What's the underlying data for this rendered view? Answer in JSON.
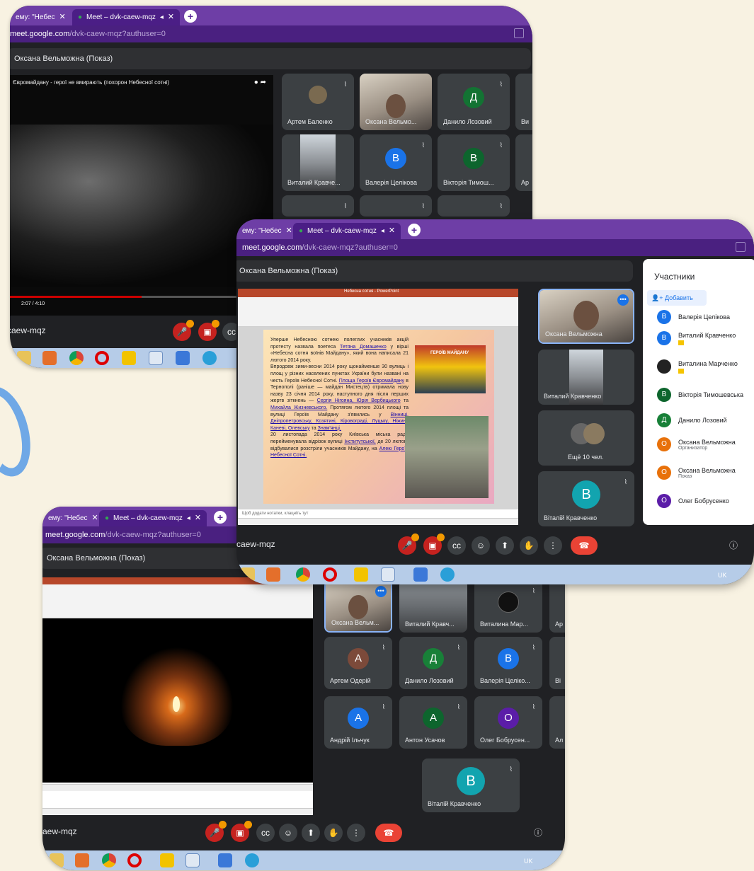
{
  "colors": {
    "bg": "#f8f2e2",
    "meet_bg": "#202124",
    "tab_bar": "#6e3ea6",
    "tile": "#3c4043",
    "end_call": "#ea4335",
    "blue": "#1a73e8",
    "green": "#137333",
    "orange": "#e8710a"
  },
  "windows": [
    {
      "tab1": "ему: \"Небес",
      "tab2": "Meet – dvk-caew-mqz",
      "url_main": "meet.google.com",
      "url_rest": "/dvk-caew-mqz?authuser=0",
      "presenting": "Оксана Вельможна (Показ)",
      "meeting": "caew-mqz",
      "video_title": "Євромайдану - герої не вмирають (похорон Небесної сотні)",
      "time": "2:07 / 4:10",
      "tiles": [
        {
          "name": "Артем Баленко"
        },
        {
          "name": "Оксана Вельмо..."
        },
        {
          "name": "Данило Лозовий",
          "letter": "Д"
        },
        {
          "name": "Ви"
        },
        {
          "name": "Виталий Кравче..."
        },
        {
          "name": "Валерія Целікова",
          "letter": "B"
        },
        {
          "name": "Вікторія Тимош...",
          "letter": "B"
        },
        {
          "name": "Ар"
        }
      ]
    },
    {
      "tab1": "ему: \"Небес",
      "tab2": "Meet – dvk-caew-mqz",
      "url_main": "meet.google.com",
      "url_rest": "/dvk-caew-mqz?authuser=0",
      "presenting": "Оксана Вельможна (Показ)",
      "meeting": "caew-mqz",
      "ppt_title": "Небесна сотня - PowerPoint",
      "tiles": [
        {
          "name": "Оксана Вельможна"
        },
        {
          "name": "Виталий Кравченко"
        },
        {
          "name": "Ещё 10 чел."
        },
        {
          "name": "Віталій Кравченко",
          "letter": "B"
        }
      ],
      "panel": {
        "title": "Участники",
        "add": "Добавить",
        "people": [
          {
            "name": "Валерія Целікова",
            "letter": "B"
          },
          {
            "name": "Виталий Кравченко",
            "letter": "B"
          },
          {
            "name": "Виталина Марченко",
            "letter": ""
          },
          {
            "name": "Вікторія Тимошевська",
            "letter": "B"
          },
          {
            "name": "Данило Лозовий",
            "letter": "Д"
          },
          {
            "name": "Оксана Вельможна",
            "letter": "O",
            "sub": "Организатор"
          },
          {
            "name": "Оксана Вельможна",
            "letter": "O",
            "sub": "Показ"
          },
          {
            "name": "Олег Бобрусенко",
            "letter": "O"
          }
        ]
      },
      "slide": {
        "p1": "Уперше Небесною сотнею полеглих учасників акцій протесту назвала поетеса",
        "l1": "Тетяна Домашенко",
        "p2": "у вірші «Небесна сотня воїнів Майдану», який вона написала 21 лютого 2014 року.",
        "p3": "Впродовж зими-весни 2014 року щонайменше 30 вулиць і площ у різних населених пунктах України були названі на честь Героїв Небесної Сотні.",
        "l2": "Площа Героїв Євромайдану",
        "p4": "в Тернополі (раніше — майдан Мистецтв) отримала нову назву 23 січня 2014 року, наступного дня після перших жертв зіткнень —",
        "l3": "Сергія Нігояна, Юрія Вербицького",
        "p5": "та",
        "l4": "Михайла Жизневського.",
        "p6": "Протягом лютого 2014 площі та вулиці Героїв Майдану з'явились у",
        "l5": "Вінниці, Дніпропетровську, Козятині, Кіровограді, Луцьку, Ніжині, Каневі, Олевську",
        "p7": "та",
        "l6": "Знам'янці.",
        "p8": "20 листопада 2014 року Київська міська рада перейменувала відрізок вулиці",
        "l7": "Інститутської,",
        "p9": "де 20 лютого відбувалися розстріли учасників Майдану, на",
        "l8": "Алею Героїв Небесної Сотні.",
        "img": "ГЕРОЇВ МАЙДАНУ",
        "notes": "Щоб додати нотатки, клацніть тут"
      },
      "lang": "UK"
    },
    {
      "tab1": "ему: \"Небес",
      "tab2": "Meet – dvk-caew-mqz",
      "url_main": "meet.google.com",
      "url_rest": "/dvk-caew-mqz?authuser=0",
      "presenting": "Оксана Вельможна (Показ)",
      "meeting": "aew-mqz",
      "tiles": [
        {
          "name": "Оксана Вельм..."
        },
        {
          "name": "Виталий Кравч..."
        },
        {
          "name": "Виталина Мар..."
        },
        {
          "name": "Ар"
        },
        {
          "name": "Артем Одерій",
          "letter": "A"
        },
        {
          "name": "Данило Лозовий",
          "letter": "Д"
        },
        {
          "name": "Валерія Целіко...",
          "letter": "B"
        },
        {
          "name": "Ві"
        },
        {
          "name": "Андрій Ільчук",
          "letter": "A"
        },
        {
          "name": "Антон Усачов",
          "letter": "A"
        },
        {
          "name": "Олег Бобрусен...",
          "letter": "O"
        },
        {
          "name": "Ал"
        },
        {
          "name": "Віталій Кравченко",
          "letter": "B"
        }
      ],
      "lang": "UK"
    }
  ]
}
